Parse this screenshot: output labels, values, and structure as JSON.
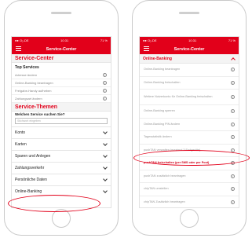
{
  "status": {
    "carrier": "●● O₂-DE",
    "time": "10:31",
    "battery": "71 %"
  },
  "app": {
    "title": "Service-Center"
  },
  "left": {
    "section_service_center": "Service-Center",
    "top_services_label": "Top Services",
    "top_services": [
      "Adresse ändern",
      "Online-Banking beantragen",
      "Freigabe-Handy aufheben",
      "Zahlungsart ändern"
    ],
    "section_themen": "Service-Themen",
    "search_question": "Welchen Service suchen Sie?",
    "search_placeholder": "Stichwort eingeben",
    "categories": [
      "Konto",
      "Karten",
      "Sparen und Anlegen",
      "Zahlungsverkehr",
      "Persönliche Daten",
      "Online-Banking"
    ]
  },
  "right": {
    "header": "Online-Banking",
    "items": [
      "Online-Banking beantragen",
      "Online-Banking freischalten",
      "Weitere Nutzerkonto für Online-Banking freischalten",
      "Online-Banking sperren",
      "Online-Banking PIN ändern",
      "Tagesstatistik ändern",
      "pushTAN verwalten (maximal 3 Endgeräte)",
      "pushTAN freischalten (per SMS oder per Post)",
      "pushTAN zusätzlich beantragen",
      "chipTAN umstellen",
      "chipTAN Zusätzlich beantragen"
    ]
  },
  "colors": {
    "brand_red": "#e2001a"
  }
}
